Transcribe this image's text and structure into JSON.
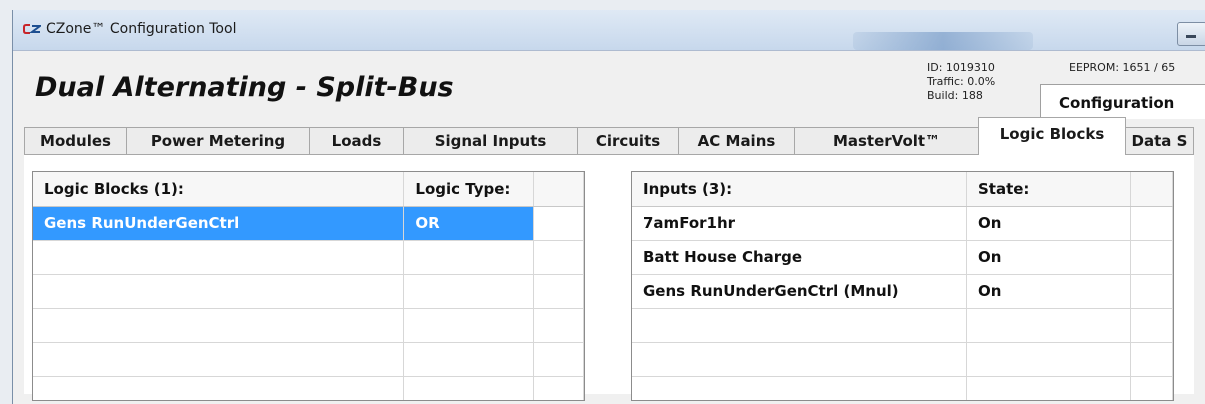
{
  "window": {
    "title": "CZone™ Configuration Tool",
    "app_icon": "cz-logo-icon"
  },
  "header": {
    "doc_title": "Dual Alternating - Split-Bus",
    "id_text": "ID: 1019310",
    "traffic_text": "Traffic: 0.0%",
    "build_text": "Build: 188",
    "eeprom_text": "EEPROM: 1651 / 65",
    "config_tab_label": "Configuration"
  },
  "tabs": [
    {
      "label": "Modules"
    },
    {
      "label": "Power Metering"
    },
    {
      "label": "Loads"
    },
    {
      "label": "Signal Inputs"
    },
    {
      "label": "Circuits"
    },
    {
      "label": "AC Mains"
    },
    {
      "label": "MasterVolt™"
    },
    {
      "label": "Logic Blocks",
      "active": true
    },
    {
      "label": "Data S"
    }
  ],
  "logic_blocks": {
    "headers": [
      "Logic Blocks (1):",
      "Logic Type:"
    ],
    "rows": [
      {
        "name": "Gens RunUnderGenCtrl",
        "type": "OR",
        "selected": true
      }
    ]
  },
  "inputs": {
    "headers": [
      "Inputs (3):",
      "State:"
    ],
    "rows": [
      {
        "name": "7amFor1hr",
        "state": "On"
      },
      {
        "name": "Batt House Charge",
        "state": "On"
      },
      {
        "name": "Gens RunUnderGenCtrl (Mnul)",
        "state": "On"
      }
    ]
  },
  "colors": {
    "selection": "#3399ff",
    "title_bar": "#c7d8ec"
  }
}
